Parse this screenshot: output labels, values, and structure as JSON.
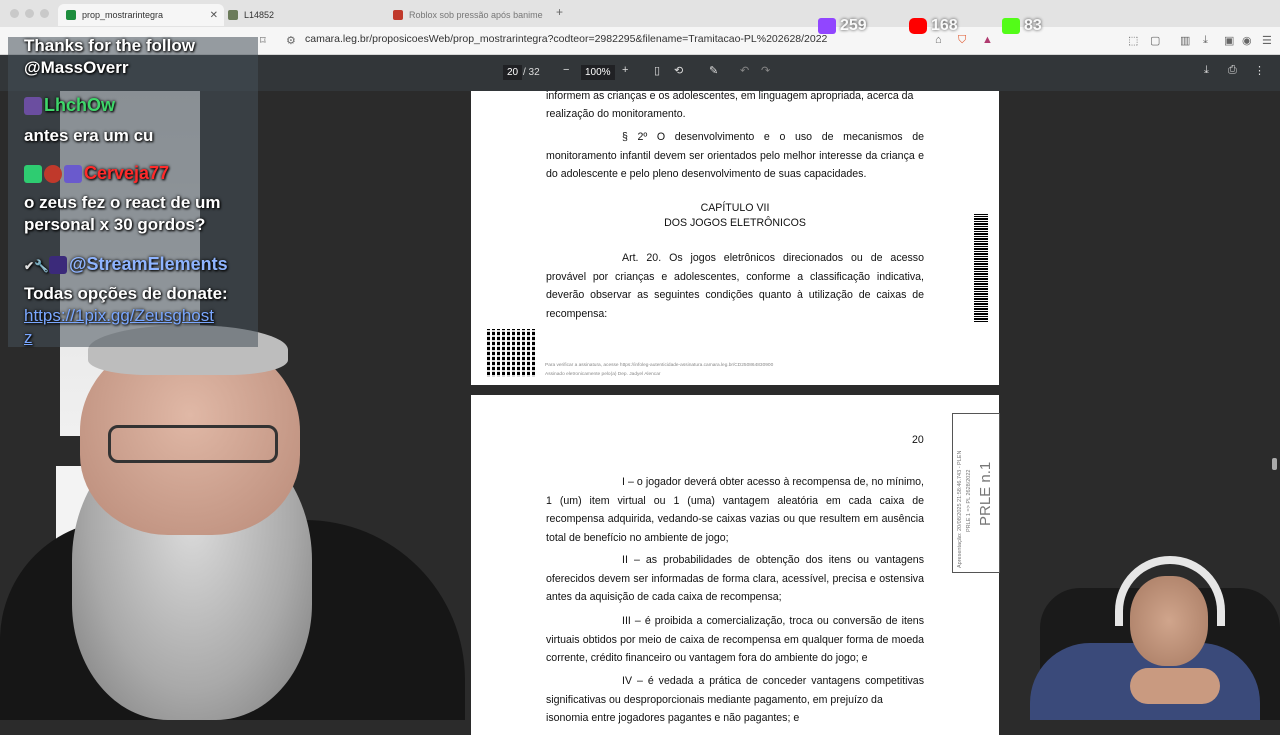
{
  "browser": {
    "tabs": [
      {
        "label": "prop_mostrarintegra",
        "color": "#1e8e3e"
      },
      {
        "label": "L14852",
        "color": "#6b7b5a"
      },
      {
        "label": "Roblox sob pressão após banime",
        "color": "#c0392b"
      }
    ],
    "url": "camara.leg.br/proposicoesWeb/prop_mostrarintegra?codteor=2982295&filename=Tramitacao-PL%202628/2022"
  },
  "pdf_toolbar": {
    "page_current": "20",
    "page_total": "/ 32",
    "zoom": "100%"
  },
  "page1": {
    "line1": "informem as crianças e os adolescentes, em linguagem apropriada, acerca da",
    "line2": "realização do monitoramento.",
    "par2": "§ 2º O desenvolvimento e o uso de mecanismos de monitoramento infantil devem ser orientados pelo melhor interesse da criança e do adolescente e pelo pleno desenvolvimento de suas capacidades.",
    "chapter": "CAPÍTULO VII",
    "chapter_title": "DOS JOGOS ELETRÔNICOS",
    "art20": "Art. 20. Os jogos eletrônicos direcionados ou de acesso provável por crianças e adolescentes, conforme a classificação indicativa, deverão observar as seguintes condições quanto à utilização de caixas de recompensa:",
    "footer1": "Para verificar a assinatura, acesse https://infoleg-autenticidade-assinatura.camara.leg.br/CD250864830900",
    "footer2": "Assinado eletronicamente pelo(a) Dep. Jadyel Alencar"
  },
  "page2": {
    "page_number": "20",
    "item1": "I – o jogador deverá obter acesso à recompensa de, no mínimo, 1 (um) item virtual ou 1 (uma) vantagem aleatória em cada caixa de recompensa adquirida, vedando-se caixas vazias ou que resultem em ausência total de benefício no ambiente de jogo;",
    "item2": "II – as probabilidades de obtenção dos itens ou vantagens oferecidos devem ser informadas de forma clara, acessível, precisa e ostensiva antes da aquisição de cada caixa de recompensa;",
    "item3": "III – é proibida a comercialização, troca ou conversão de itens virtuais obtidos por meio de caixa de recompensa  em qualquer forma de moeda corrente, crédito financeiro ou vantagem fora do ambiente do jogo; e",
    "item4a": "IV – é vedada a prática de conceder vantagens competitivas significativas ou desproporcionais mediante pagamento, em prejuízo da",
    "item4b": "isonomia entre jogadores pagantes e não pagantes; e",
    "stamp_big": "PRLE n.1",
    "stamp_small1": "Apresentação: 20/08/2025 21:58:46.743 - PLEN",
    "stamp_small2": "PRLE 1 => PL 2628/2022"
  },
  "chat": {
    "follow_line1": "Thanks for the follow",
    "follow_line2": "@MassOverr",
    "msg1_user": "LhchOw",
    "msg1_text": "antes era um cu",
    "msg2_user": "Cerveja77",
    "msg2_text1": "o zeus fez o react de um",
    "msg2_text2": "personal x 30 gordos?",
    "msg3_user": "@StreamElements",
    "msg3_text1": "Todas opções de donate:",
    "msg3_link1": "https://1pix.gg/Zeusghost",
    "msg3_link2": "z",
    "colors": {
      "user1": "#3fd66a",
      "user2": "#ff2a2a",
      "user3": "#8fb4ff",
      "link": "#7aa7ff"
    }
  },
  "socials": {
    "twitch": "259",
    "youtube": "168",
    "kick": "83"
  }
}
